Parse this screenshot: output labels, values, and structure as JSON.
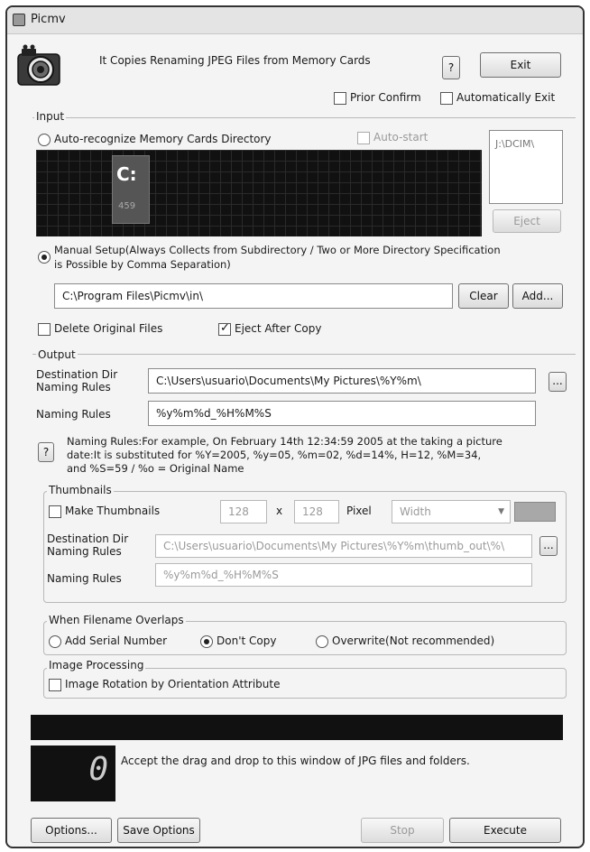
{
  "window": {
    "title": "Picmv"
  },
  "header": {
    "description": "It Copies Renaming JPEG Files from Memory Cards",
    "help_label": "?",
    "exit_label": "Exit",
    "prior_confirm": {
      "label": "Prior Confirm",
      "checked": false
    },
    "auto_exit": {
      "label": "Automatically Exit",
      "checked": false
    }
  },
  "input": {
    "legend": "Input",
    "auto_recognize": {
      "label": "Auto-recognize Memory Cards Directory",
      "selected": false
    },
    "auto_start": {
      "label": "Auto-start",
      "checked": false
    },
    "drive": {
      "letter": "C:",
      "size": "459"
    },
    "card_dir": "J:\\DCIM\\",
    "eject_label": "Eject",
    "manual": {
      "label_line1": "Manual Setup(Always Collects from Subdirectory / Two or More Directory Specification",
      "label_line2": "is Possible by Comma Separation)",
      "selected": true
    },
    "manual_path": "C:\\Program Files\\Picmv\\in\\",
    "clear_label": "Clear",
    "add_label": "Add...",
    "delete_original": {
      "label": "Delete Original Files",
      "checked": false
    },
    "eject_after": {
      "label": "Eject After Copy",
      "checked": true
    }
  },
  "output": {
    "legend": "Output",
    "dest_dir_label": "Destination Dir",
    "dest_naming_label": "Naming Rules",
    "dest_dir_value": "C:\\Users\\usuario\\Documents\\My Pictures\\%Y%m\\",
    "browse_label": "...",
    "naming_rules_label": "Naming Rules",
    "naming_rules_value": "%y%m%d_%H%M%S",
    "help_label": "?",
    "help_text_1": "Naming Rules:For example, On February 14th 12:34:59 2005 at the taking a picture",
    "help_text_2": "date:It is substituted for %Y=2005, %y=05, %m=02, %d=14%, H=12, %M=34,",
    "help_text_3": "and %S=59 / %o = Original Name"
  },
  "thumbnails": {
    "legend": "Thumbnails",
    "make": {
      "label": "Make Thumbnails",
      "checked": false
    },
    "width": "128",
    "x_label": "x",
    "height": "128",
    "pixel_label": "Pixel",
    "fit_option": "Width",
    "dest_dir_label": "Destination Dir",
    "dest_naming_label": "Naming Rules",
    "dest_dir_value": "C:\\Users\\usuario\\Documents\\My Pictures\\%Y%m\\thumb_out\\%\\",
    "browse_label": "...",
    "naming_rules_label": "Naming Rules",
    "naming_rules_value": "%y%m%d_%H%M%S",
    "swatch_color": "#a8a8a8"
  },
  "overlap": {
    "legend": "When Filename Overlaps",
    "serial": {
      "label": "Add Serial Number",
      "selected": false
    },
    "dont_copy": {
      "label": "Don't Copy",
      "selected": true
    },
    "overwrite": {
      "label": "Overwrite(Not recommended)",
      "selected": false
    }
  },
  "image_processing": {
    "legend": "Image Processing",
    "rotation": {
      "label": "Image Rotation by Orientation Attribute",
      "checked": false
    }
  },
  "status": {
    "counter": "0",
    "message": "Accept the drag and drop to this window of JPG files and folders."
  },
  "footer": {
    "options_label": "Options...",
    "save_options_label": "Save Options",
    "stop_label": "Stop",
    "execute_label": "Execute"
  }
}
